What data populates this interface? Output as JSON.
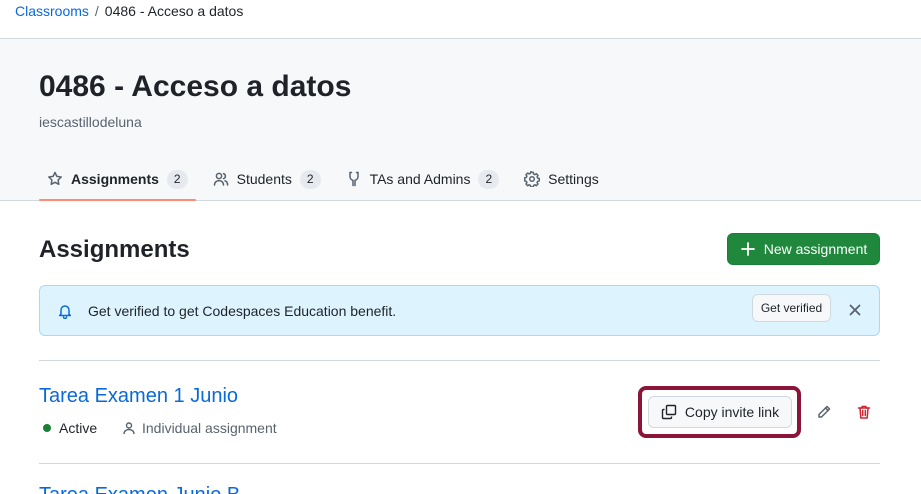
{
  "breadcrumb": {
    "parent": "Classrooms",
    "separator": "/",
    "current": "0486 - Acceso a datos"
  },
  "header": {
    "title": "0486 - Acceso a datos",
    "org": "iescastillodeluna"
  },
  "tabs": [
    {
      "label": "Assignments",
      "count": "2",
      "icon": "star-icon",
      "selected": true
    },
    {
      "label": "Students",
      "count": "2",
      "icon": "people-icon",
      "selected": false
    },
    {
      "label": "TAs and Admins",
      "count": "2",
      "icon": "mortar-board-icon",
      "selected": false
    },
    {
      "label": "Settings",
      "icon": "gear-icon",
      "selected": false
    }
  ],
  "main": {
    "section_title": "Assignments",
    "new_button_label": "New assignment"
  },
  "flash": {
    "message": "Get verified to get Codespaces Education benefit.",
    "button_label": "Get verified"
  },
  "assignments": [
    {
      "title": "Tarea Examen 1 Junio",
      "status": "Active",
      "type": "Individual assignment",
      "copy_label": "Copy invite link"
    },
    {
      "title": "Tarea Examen Junio B"
    }
  ],
  "colors": {
    "link": "#0969da",
    "primary": "#1f883d",
    "highlight": "#8a1538",
    "danger": "#d1242f",
    "active_dot": "#1a7f37",
    "tab_underline": "#fd8c73"
  }
}
